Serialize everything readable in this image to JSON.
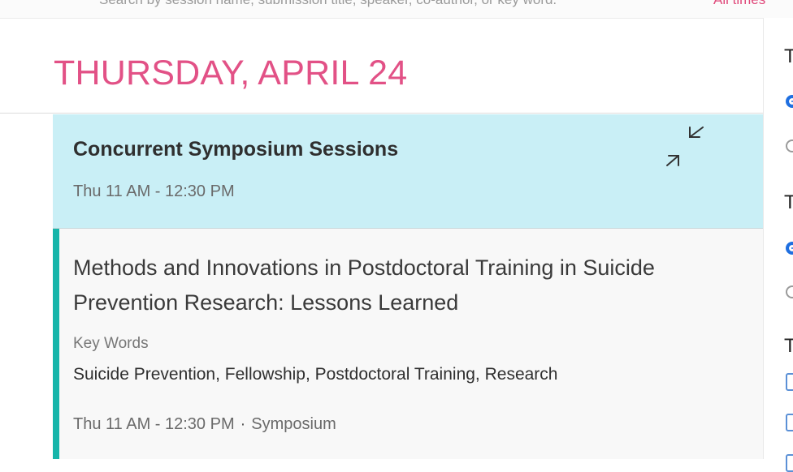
{
  "topbar": {
    "search_hint": "Search by session name, submission title, speaker, co-author, or key word.",
    "all_link": "All times"
  },
  "day": {
    "title": "THURSDAY, APRIL 24"
  },
  "session": {
    "title": "Concurrent Symposium Sessions",
    "time": "Thu 11 AM - 12:30 PM",
    "collapse_icon": "collapse-arrows-icon"
  },
  "card": {
    "title": "Methods and Innovations in Postdoctoral Training in Suicide Prevention Research: Lessons Learned",
    "keywords_label": "Key Words",
    "keywords": "Suicide Prevention, Fellowship, Postdoctoral Training, Research",
    "time": "Thu 11 AM - 12:30 PM",
    "separator": "·",
    "type": "Symposium"
  },
  "right_filters": {
    "heading1": "T",
    "heading2": "T",
    "heading3": "T"
  },
  "colors": {
    "accent_pink": "#e25186",
    "session_bg": "#c9eff6",
    "card_bar": "#16b5aa",
    "radio_blue": "#1f6fe0"
  }
}
